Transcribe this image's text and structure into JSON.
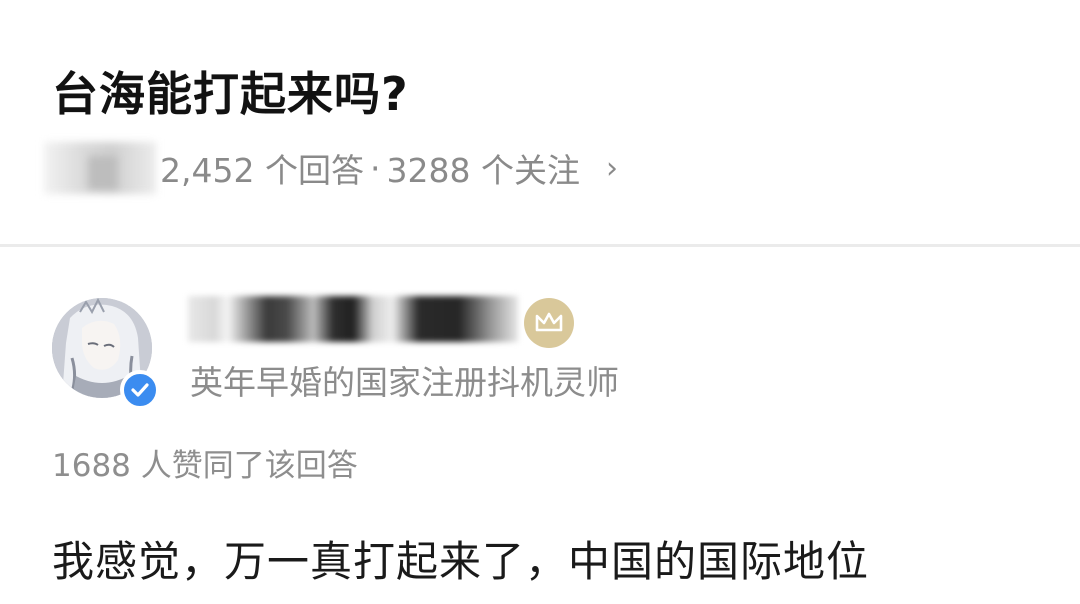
{
  "question": {
    "title": "台海能打起来吗?",
    "answer_count": "2,452 个回答",
    "separator": "·",
    "follow_count": "3288 个关注",
    "chevron": "›"
  },
  "answer": {
    "author": {
      "bio": "英年早婚的国家注册抖机灵师",
      "avatar_icon": "anime-avatar",
      "verified_icon": "verified-check-icon",
      "badge_icon": "crown-icon"
    },
    "votes_text": "1688 人赞同了该回答",
    "body": "我感觉，万一真打起来了，中国的国际地位"
  },
  "colors": {
    "title": "#121212",
    "meta": "#8a8a8a",
    "verified": "#3b8cf0",
    "crown_badge": "#d9c89a",
    "divider": "#ebebeb"
  }
}
